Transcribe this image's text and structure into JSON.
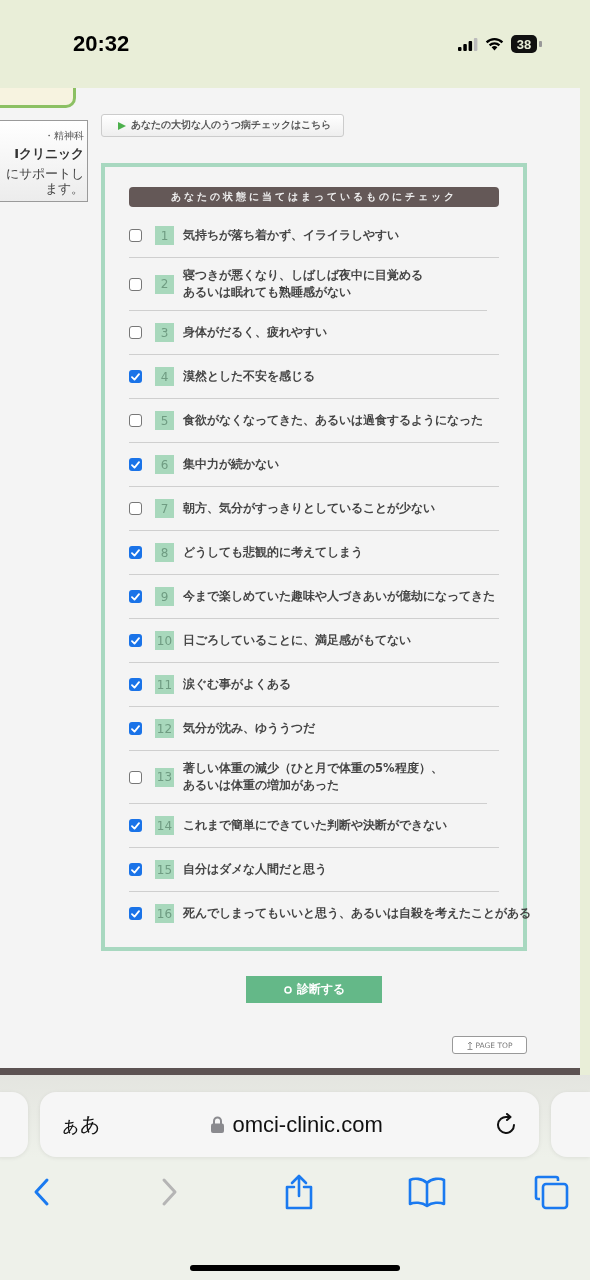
{
  "status_bar": {
    "time": "20:32",
    "battery": "38"
  },
  "sidebar": {
    "clinic_category": "・精神科",
    "clinic_name": "Iクリニック",
    "tagline": "にサポートします。"
  },
  "link_button": {
    "label": "あなたの大切な人のうつ病チェックはこちら"
  },
  "checklist": {
    "heading": "あなたの状態に当てはまっているものにチェック",
    "items": [
      {
        "number": "1",
        "lines": [
          "気持ちが落ち着かず、イライラしやすい"
        ],
        "checked": false
      },
      {
        "number": "2",
        "lines": [
          "寝つきが悪くなり、しばしば夜中に目覚める",
          "あるいは眠れても熟睡感がない"
        ],
        "checked": false
      },
      {
        "number": "3",
        "lines": [
          "身体がだるく、疲れやすい"
        ],
        "checked": false
      },
      {
        "number": "4",
        "lines": [
          "漠然とした不安を感じる"
        ],
        "checked": true
      },
      {
        "number": "5",
        "lines": [
          "食欲がなくなってきた、あるいは過食するようになった"
        ],
        "checked": false
      },
      {
        "number": "6",
        "lines": [
          "集中力が続かない"
        ],
        "checked": true
      },
      {
        "number": "7",
        "lines": [
          "朝方、気分がすっきりとしていることが少ない"
        ],
        "checked": false
      },
      {
        "number": "8",
        "lines": [
          "どうしても悲観的に考えてしまう"
        ],
        "checked": true
      },
      {
        "number": "9",
        "lines": [
          "今まで楽しめていた趣味や人づきあいが億劫になってきた"
        ],
        "checked": true
      },
      {
        "number": "10",
        "lines": [
          "日ごろしていることに、満足感がもてない"
        ],
        "checked": true
      },
      {
        "number": "11",
        "lines": [
          "涙ぐむ事がよくある"
        ],
        "checked": true
      },
      {
        "number": "12",
        "lines": [
          "気分が沈み、ゆううつだ"
        ],
        "checked": true
      },
      {
        "number": "13",
        "lines": [
          "著しい体重の減少（ひと月で体重の5%程度）、",
          "あるいは体重の増加があった"
        ],
        "checked": false
      },
      {
        "number": "14",
        "lines": [
          "これまで簡単にできていた判断や決断ができない"
        ],
        "checked": true
      },
      {
        "number": "15",
        "lines": [
          "自分はダメな人間だと思う"
        ],
        "checked": true
      },
      {
        "number": "16",
        "lines": [
          "死んでしまってもいいと思う、あるいは自殺を考えたことがある"
        ],
        "checked": true
      }
    ]
  },
  "diagnose_button": {
    "label": "診断する"
  },
  "page_top_button": {
    "label": "PAGE TOP"
  },
  "browser": {
    "text_size_button": "ぁあ",
    "url": "omci-clinic.com"
  }
}
